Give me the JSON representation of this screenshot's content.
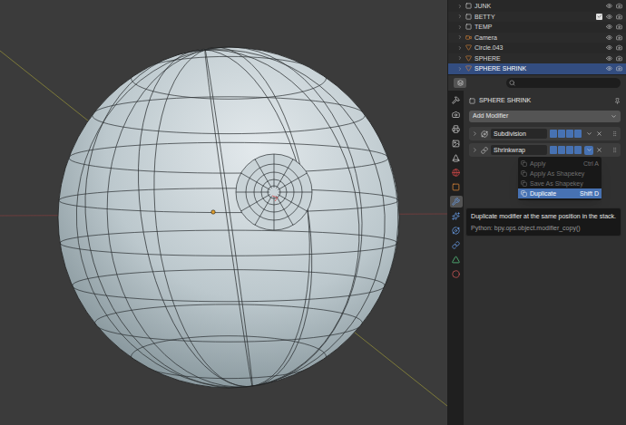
{
  "outliner": {
    "items": [
      {
        "name": "JUNK",
        "kind": "collection",
        "selected": false,
        "checked": false
      },
      {
        "name": "BETTY",
        "kind": "collection",
        "selected": false,
        "checked": true
      },
      {
        "name": "TEMP",
        "kind": "collection",
        "selected": false,
        "checked": false
      },
      {
        "name": "Camera",
        "kind": "camera",
        "selected": false,
        "checked": false
      },
      {
        "name": "Circle.043",
        "kind": "mesh",
        "selected": false,
        "checked": false
      },
      {
        "name": "SPHERE",
        "kind": "mesh",
        "selected": false,
        "checked": false
      },
      {
        "name": "SPHERE SHRINK",
        "kind": "mesh",
        "selected": true,
        "checked": false
      }
    ]
  },
  "properties": {
    "search": {
      "placeholder": ""
    },
    "tabs": [
      {
        "kind": "tool",
        "selected": false
      },
      {
        "kind": "render",
        "selected": false
      },
      {
        "kind": "output",
        "selected": false
      },
      {
        "kind": "view_layer",
        "selected": false
      },
      {
        "kind": "scene",
        "selected": false
      },
      {
        "kind": "world",
        "selected": false
      },
      {
        "kind": "object",
        "selected": false
      },
      {
        "kind": "modifiers",
        "selected": true
      },
      {
        "kind": "particles",
        "selected": false
      },
      {
        "kind": "physics",
        "selected": false
      },
      {
        "kind": "constraints",
        "selected": false
      },
      {
        "kind": "data",
        "selected": false
      },
      {
        "kind": "material",
        "selected": false
      }
    ],
    "object_name": "SPHERE SHRINK",
    "add_modifier": "Add Modifier",
    "modifiers": [
      {
        "name": "Subdivision",
        "kind": "subdivision",
        "expanded": false,
        "menu_open": false
      },
      {
        "name": "Shrinkwrap",
        "kind": "shrinkwrap",
        "expanded": false,
        "menu_open": true
      }
    ]
  },
  "menu": {
    "items": [
      {
        "label": "Apply",
        "shortcut": "Ctrl A",
        "disabled": true,
        "selected": false
      },
      {
        "label": "Apply As Shapekey",
        "shortcut": "",
        "disabled": true,
        "selected": false
      },
      {
        "label": "Save As Shapekey",
        "shortcut": "",
        "disabled": true,
        "selected": false
      },
      {
        "label": "Duplicate",
        "shortcut": "Shift D",
        "disabled": false,
        "selected": true
      }
    ]
  },
  "tooltip": {
    "text": "Duplicate modifier at the same position in the stack.",
    "python": "Python: bpy.ops.object.modifier_copy()"
  }
}
